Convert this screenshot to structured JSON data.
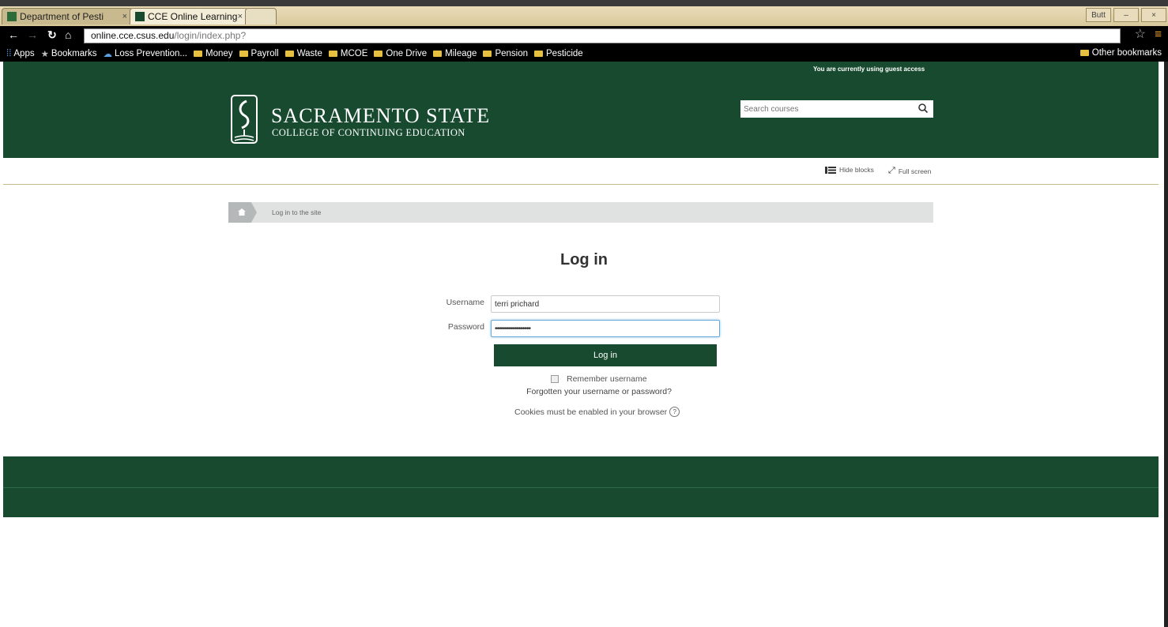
{
  "browser": {
    "tabs": [
      {
        "title": "Department of Pesti"
      },
      {
        "title": "CCE Online Learning"
      }
    ],
    "window_controls": [
      "Butt",
      "",
      ""
    ],
    "url_host": "online.cce.csus.edu",
    "url_path": "/login/index.php?",
    "bookmarks": [
      "Apps",
      "Bookmarks",
      "Loss Prevention...",
      "Money",
      "Payroll",
      "Waste",
      "MCOE",
      "One Drive",
      "Mileage",
      "Pension",
      "Pesticide"
    ],
    "other_bookmarks": "Other bookmarks"
  },
  "header": {
    "guest_notice": "You are currently using guest access",
    "logo_title": "SACRAMENTO STATE",
    "logo_subtitle": "COLLEGE OF CONTINUING EDUCATION",
    "search_placeholder": "Search courses"
  },
  "toolbar": {
    "hide_blocks": "Hide blocks",
    "full_screen": "Full screen"
  },
  "breadcrumb": {
    "current": "Log in to the site"
  },
  "login": {
    "title": "Log in",
    "username_label": "Username",
    "username_value": "terri prichard",
    "password_label": "Password",
    "password_value": "••••••••••••••••••",
    "button": "Log in",
    "remember": "Remember username",
    "forgot": "Forgotten your username or password?",
    "cookies": "Cookies must be enabled in your browser"
  },
  "colors": {
    "brand_green": "#174a2f",
    "gold_rule": "#c9b98a"
  }
}
